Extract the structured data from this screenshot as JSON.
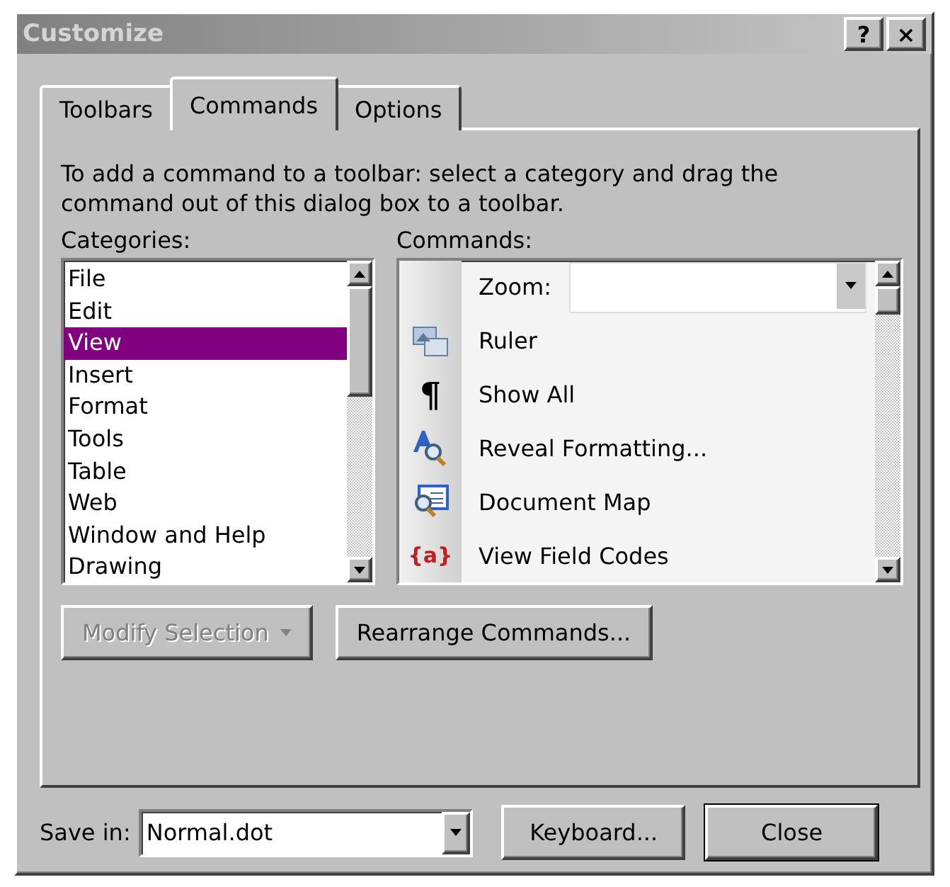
{
  "window": {
    "title": "Customize",
    "title_buttons": [
      "?",
      "×"
    ]
  },
  "tabs": [
    {
      "label": "Toolbars",
      "selected": false
    },
    {
      "label": "Commands",
      "selected": true
    },
    {
      "label": "Options",
      "selected": false
    }
  ],
  "instructions": "To add a command to a toolbar: select a category and drag the command out of this dialog box to a toolbar.",
  "categories": {
    "label": "Categories:",
    "items": [
      {
        "label": "File",
        "selected": false
      },
      {
        "label": "Edit",
        "selected": false
      },
      {
        "label": "View",
        "selected": true
      },
      {
        "label": "Insert",
        "selected": false
      },
      {
        "label": "Format",
        "selected": false
      },
      {
        "label": "Tools",
        "selected": false
      },
      {
        "label": "Table",
        "selected": false
      },
      {
        "label": "Web",
        "selected": false
      },
      {
        "label": "Window and Help",
        "selected": false
      },
      {
        "label": "Drawing",
        "selected": false
      }
    ]
  },
  "commands": {
    "label": "Commands:",
    "items": [
      {
        "kind": "combo",
        "label": "Zoom:"
      },
      {
        "kind": "command",
        "label": "Ruler"
      },
      {
        "kind": "command",
        "glyph": "¶",
        "label": "Show All"
      },
      {
        "kind": "command",
        "label": "Reveal Formatting..."
      },
      {
        "kind": "command",
        "label": "Document Map"
      },
      {
        "kind": "command",
        "glyph": "{a}",
        "label": "View Field Codes"
      }
    ]
  },
  "buttons": [
    {
      "label": "Modify Selection",
      "disabled": true,
      "dropdown": true
    },
    {
      "label": "Rearrange Commands...",
      "disabled": false,
      "dropdown": false
    }
  ],
  "save_in": {
    "label": "Save in:",
    "value": "Normal.dot"
  },
  "footer_buttons": [
    {
      "label": "Keyboard...",
      "default": false
    },
    {
      "label": "Close",
      "default": true
    }
  ]
}
